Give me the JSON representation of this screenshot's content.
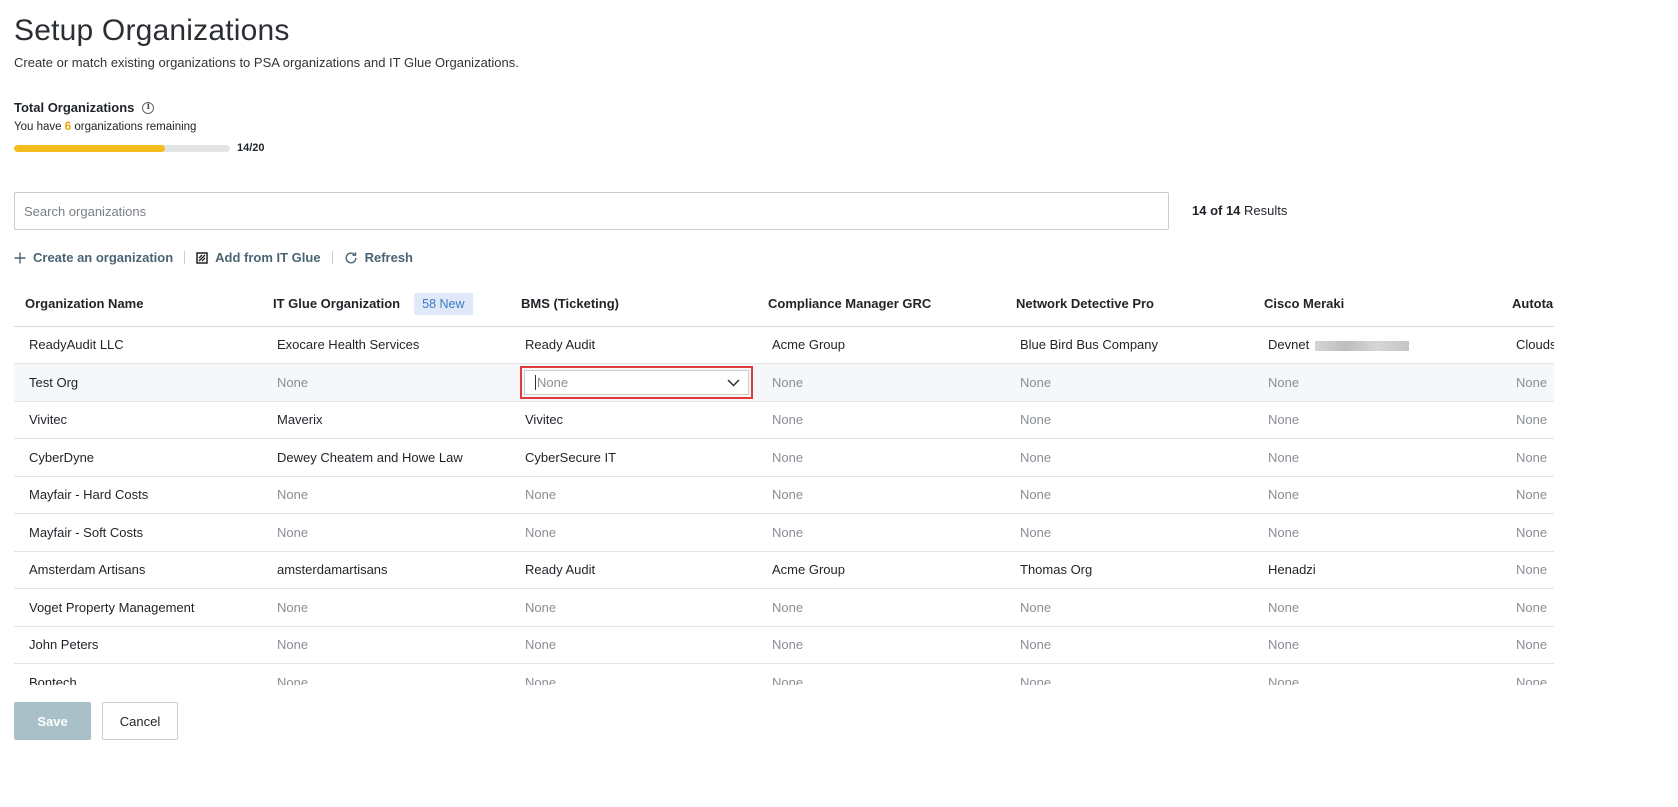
{
  "header": {
    "title": "Setup Organizations",
    "subtitle": "Create or match existing organizations to PSA organizations and IT Glue Organizations."
  },
  "totals": {
    "label": "Total Organizations",
    "remaining_prefix": "You have",
    "remaining_count": "6",
    "remaining_suffix": "organizations remaining",
    "progress_text": "14/20",
    "progress_fraction": 0.7,
    "progress_color": "#f5bd1c"
  },
  "search": {
    "placeholder": "Search organizations",
    "value": ""
  },
  "results": {
    "count": "14 of 14",
    "label": "Results"
  },
  "actions": {
    "create": "Create an organization",
    "add_itglue": "Add from IT Glue",
    "refresh": "Refresh"
  },
  "table": {
    "columns": [
      "Organization Name",
      "IT Glue Organization",
      "BMS (Ticketing)",
      "Compliance Manager GRC",
      "Network Detective Pro",
      "Cisco Meraki",
      "Autotas"
    ],
    "new_badge": "58 New",
    "rows": [
      [
        "ReadyAudit LLC",
        "Exocare Health Services",
        "Ready Audit",
        "Acme Group",
        "Blue Bird Bus Company",
        "Devnet",
        "Clouds"
      ],
      [
        "Test Org",
        "None",
        "None",
        "None",
        "None",
        "None",
        "None"
      ],
      [
        "Vivitec",
        "Maverix",
        "Vivitec",
        "None",
        "None",
        "None",
        "None"
      ],
      [
        "CyberDyne",
        "Dewey Cheatem and Howe Law",
        "CyberSecure IT",
        "None",
        "None",
        "None",
        "None"
      ],
      [
        "Mayfair - Hard Costs",
        "None",
        "None",
        "None",
        "None",
        "None",
        "None"
      ],
      [
        "Mayfair - Soft Costs",
        "None",
        "None",
        "None",
        "None",
        "None",
        "None"
      ],
      [
        "Amsterdam Artisans",
        "amsterdamartisans",
        "Ready Audit",
        "Acme Group",
        "Thomas Org",
        "Henadzi",
        "None"
      ],
      [
        "Voget Property Management",
        "None",
        "None",
        "None",
        "None",
        "None",
        "None"
      ],
      [
        "John Peters",
        "None",
        "None",
        "None",
        "None",
        "None",
        "None"
      ],
      [
        "Bontech",
        "None",
        "None",
        "None",
        "None",
        "None",
        "None"
      ]
    ]
  },
  "footer": {
    "save": "Save",
    "cancel": "Cancel"
  }
}
